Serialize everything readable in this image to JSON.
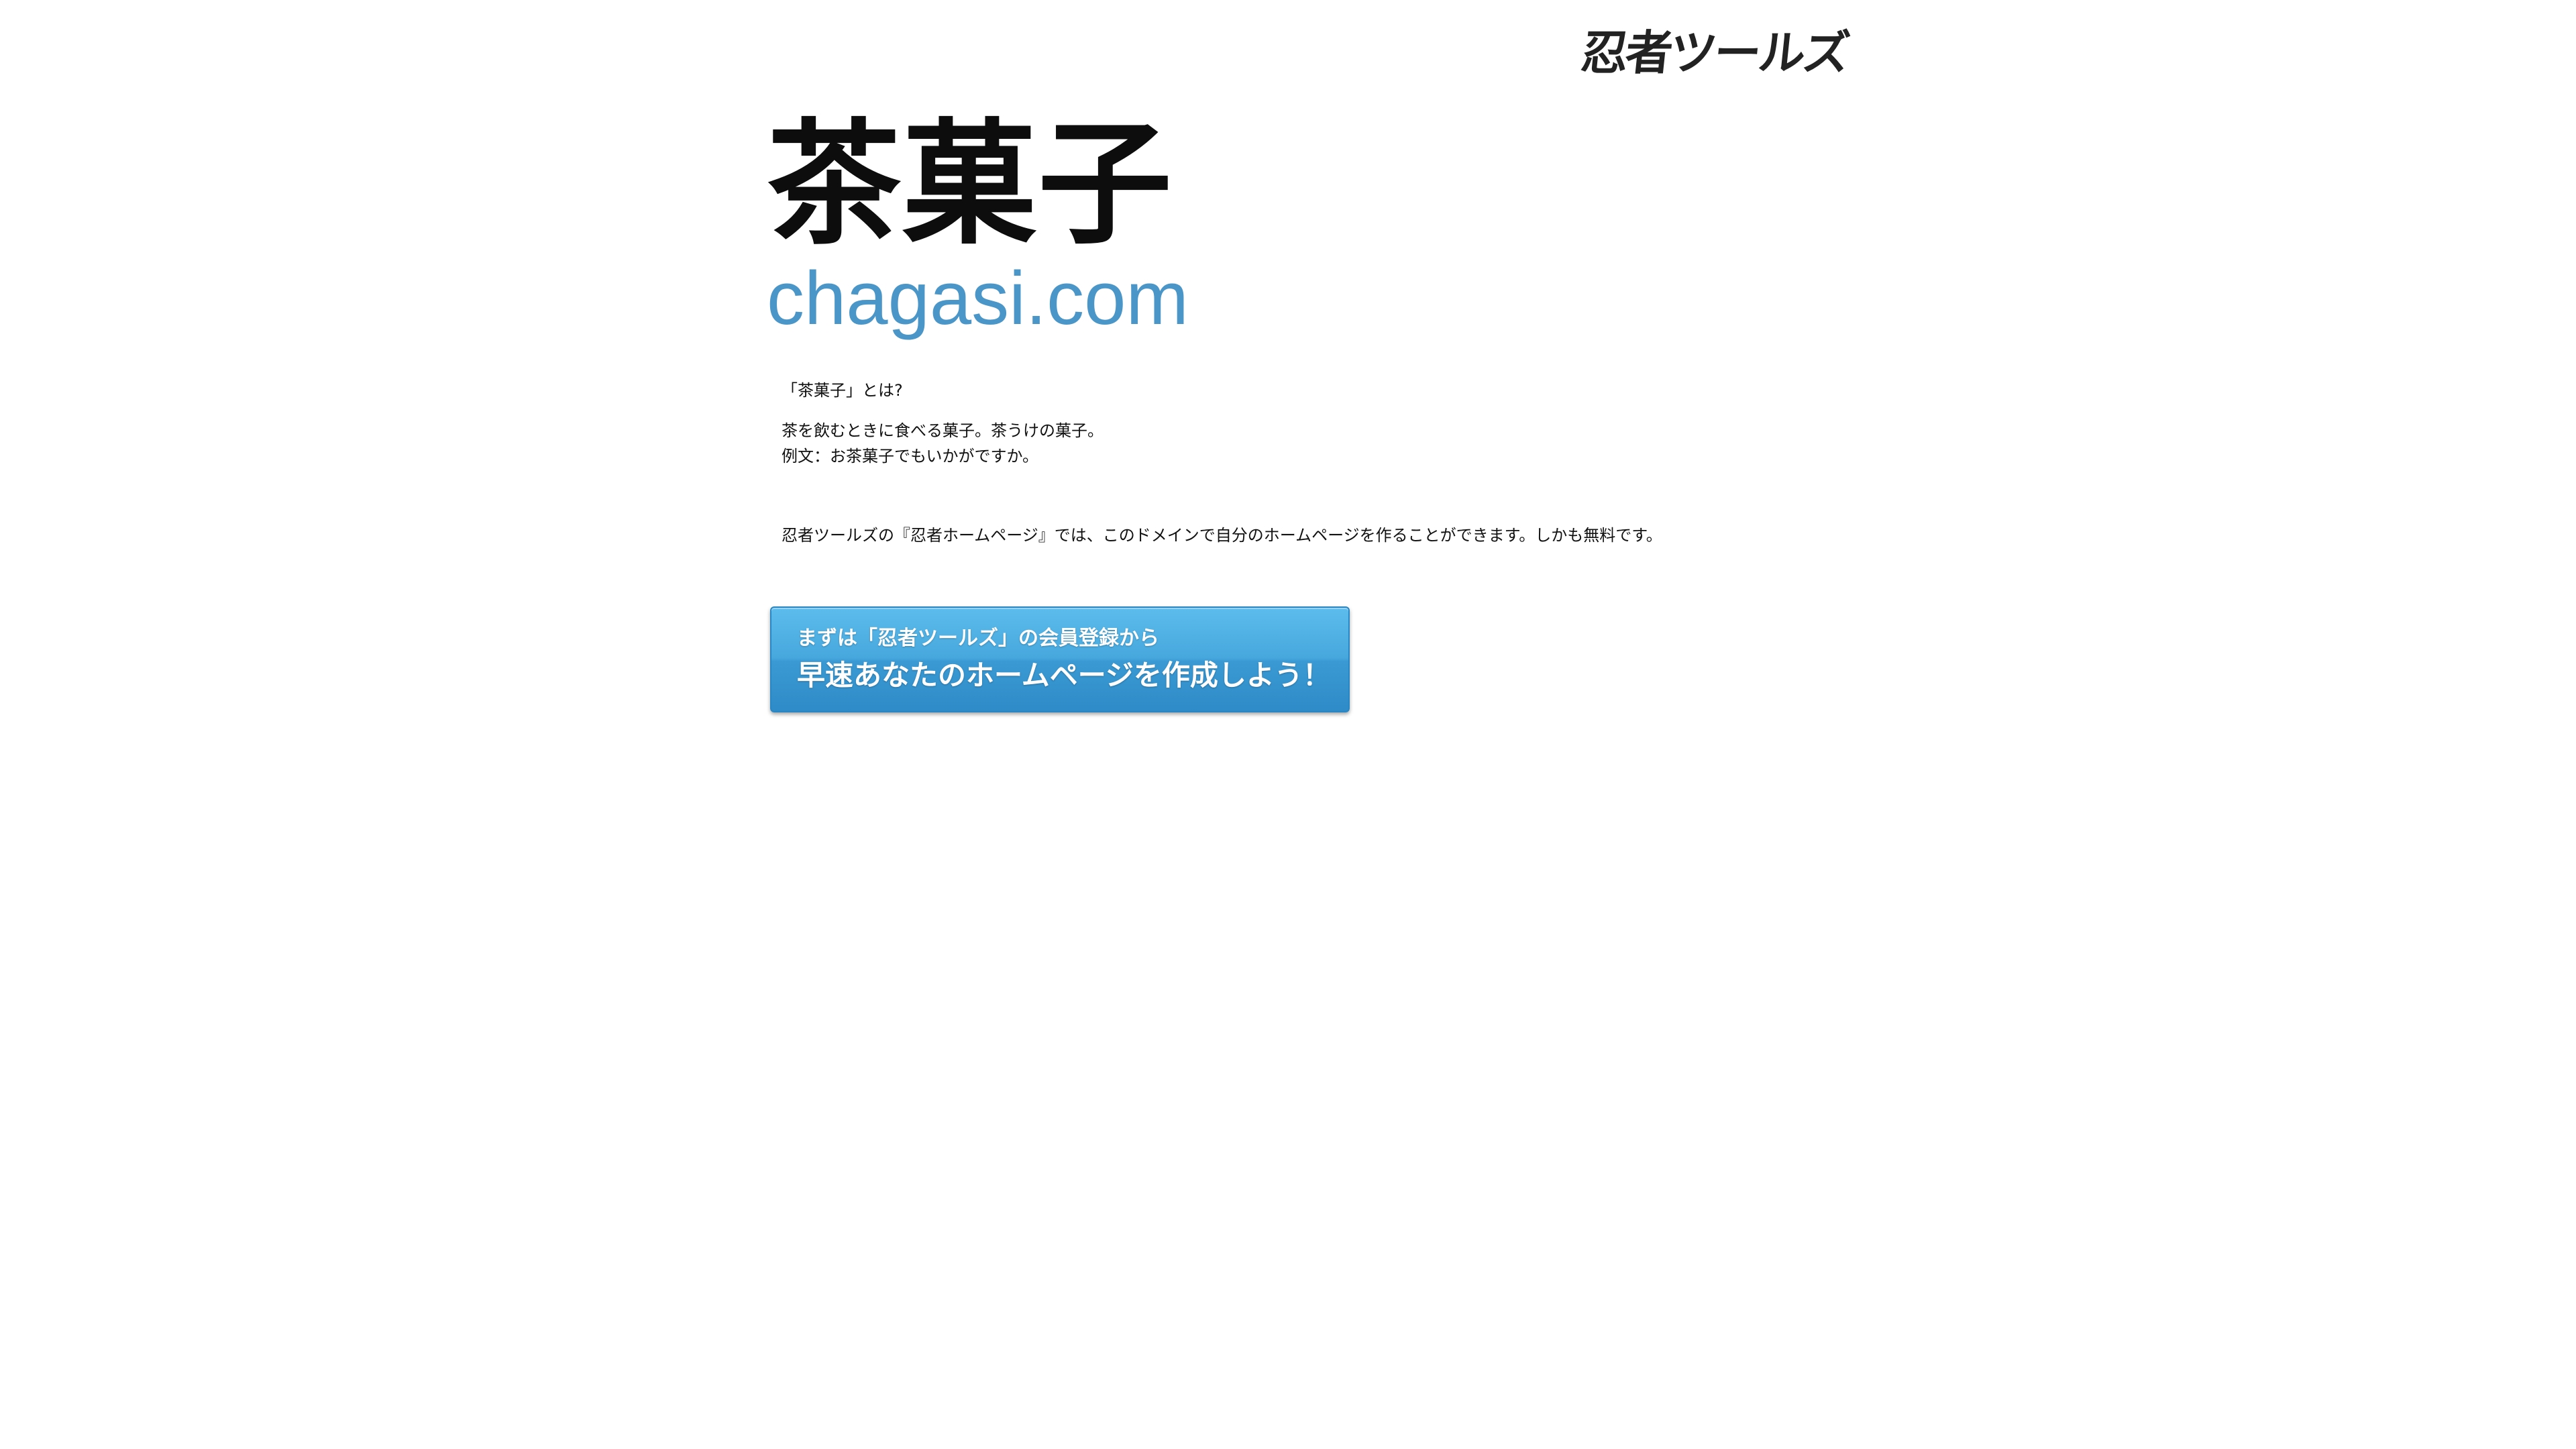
{
  "brand": {
    "logo_text": "忍者ツールズ"
  },
  "header": {
    "title": "茶菓子",
    "domain": "chagasi.com"
  },
  "definition": {
    "question": "「茶菓子」とは?",
    "meaning": "茶を飲むときに食べる菓子。茶うけの菓子。",
    "example": "例文：お茶菓子でもいかがですか。"
  },
  "promo": {
    "text": "忍者ツールズの『忍者ホームページ』では、このドメインで自分のホームページを作ることができます。しかも無料です。"
  },
  "cta": {
    "line1": "まずは「忍者ツールズ」の会員登録から",
    "line2": "早速あなたのホームページを作成しよう！"
  },
  "colors": {
    "domain_text": "#4a96c8",
    "button_top": "#5cbcec",
    "button_bottom": "#2f8bc7",
    "button_text": "#ffffff"
  }
}
